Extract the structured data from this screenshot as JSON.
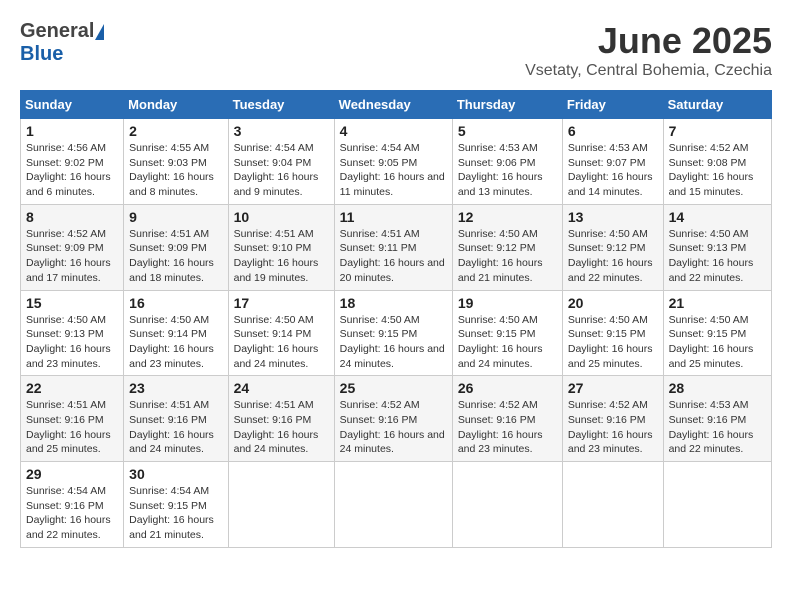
{
  "header": {
    "logo_general": "General",
    "logo_blue": "Blue",
    "month_title": "June 2025",
    "location": "Vsetaty, Central Bohemia, Czechia"
  },
  "weekdays": [
    "Sunday",
    "Monday",
    "Tuesday",
    "Wednesday",
    "Thursday",
    "Friday",
    "Saturday"
  ],
  "weeks": [
    [
      {
        "day": "1",
        "sunrise": "Sunrise: 4:56 AM",
        "sunset": "Sunset: 9:02 PM",
        "daylight": "Daylight: 16 hours and 6 minutes."
      },
      {
        "day": "2",
        "sunrise": "Sunrise: 4:55 AM",
        "sunset": "Sunset: 9:03 PM",
        "daylight": "Daylight: 16 hours and 8 minutes."
      },
      {
        "day": "3",
        "sunrise": "Sunrise: 4:54 AM",
        "sunset": "Sunset: 9:04 PM",
        "daylight": "Daylight: 16 hours and 9 minutes."
      },
      {
        "day": "4",
        "sunrise": "Sunrise: 4:54 AM",
        "sunset": "Sunset: 9:05 PM",
        "daylight": "Daylight: 16 hours and 11 minutes."
      },
      {
        "day": "5",
        "sunrise": "Sunrise: 4:53 AM",
        "sunset": "Sunset: 9:06 PM",
        "daylight": "Daylight: 16 hours and 13 minutes."
      },
      {
        "day": "6",
        "sunrise": "Sunrise: 4:53 AM",
        "sunset": "Sunset: 9:07 PM",
        "daylight": "Daylight: 16 hours and 14 minutes."
      },
      {
        "day": "7",
        "sunrise": "Sunrise: 4:52 AM",
        "sunset": "Sunset: 9:08 PM",
        "daylight": "Daylight: 16 hours and 15 minutes."
      }
    ],
    [
      {
        "day": "8",
        "sunrise": "Sunrise: 4:52 AM",
        "sunset": "Sunset: 9:09 PM",
        "daylight": "Daylight: 16 hours and 17 minutes."
      },
      {
        "day": "9",
        "sunrise": "Sunrise: 4:51 AM",
        "sunset": "Sunset: 9:09 PM",
        "daylight": "Daylight: 16 hours and 18 minutes."
      },
      {
        "day": "10",
        "sunrise": "Sunrise: 4:51 AM",
        "sunset": "Sunset: 9:10 PM",
        "daylight": "Daylight: 16 hours and 19 minutes."
      },
      {
        "day": "11",
        "sunrise": "Sunrise: 4:51 AM",
        "sunset": "Sunset: 9:11 PM",
        "daylight": "Daylight: 16 hours and 20 minutes."
      },
      {
        "day": "12",
        "sunrise": "Sunrise: 4:50 AM",
        "sunset": "Sunset: 9:12 PM",
        "daylight": "Daylight: 16 hours and 21 minutes."
      },
      {
        "day": "13",
        "sunrise": "Sunrise: 4:50 AM",
        "sunset": "Sunset: 9:12 PM",
        "daylight": "Daylight: 16 hours and 22 minutes."
      },
      {
        "day": "14",
        "sunrise": "Sunrise: 4:50 AM",
        "sunset": "Sunset: 9:13 PM",
        "daylight": "Daylight: 16 hours and 22 minutes."
      }
    ],
    [
      {
        "day": "15",
        "sunrise": "Sunrise: 4:50 AM",
        "sunset": "Sunset: 9:13 PM",
        "daylight": "Daylight: 16 hours and 23 minutes."
      },
      {
        "day": "16",
        "sunrise": "Sunrise: 4:50 AM",
        "sunset": "Sunset: 9:14 PM",
        "daylight": "Daylight: 16 hours and 23 minutes."
      },
      {
        "day": "17",
        "sunrise": "Sunrise: 4:50 AM",
        "sunset": "Sunset: 9:14 PM",
        "daylight": "Daylight: 16 hours and 24 minutes."
      },
      {
        "day": "18",
        "sunrise": "Sunrise: 4:50 AM",
        "sunset": "Sunset: 9:15 PM",
        "daylight": "Daylight: 16 hours and 24 minutes."
      },
      {
        "day": "19",
        "sunrise": "Sunrise: 4:50 AM",
        "sunset": "Sunset: 9:15 PM",
        "daylight": "Daylight: 16 hours and 24 minutes."
      },
      {
        "day": "20",
        "sunrise": "Sunrise: 4:50 AM",
        "sunset": "Sunset: 9:15 PM",
        "daylight": "Daylight: 16 hours and 25 minutes."
      },
      {
        "day": "21",
        "sunrise": "Sunrise: 4:50 AM",
        "sunset": "Sunset: 9:15 PM",
        "daylight": "Daylight: 16 hours and 25 minutes."
      }
    ],
    [
      {
        "day": "22",
        "sunrise": "Sunrise: 4:51 AM",
        "sunset": "Sunset: 9:16 PM",
        "daylight": "Daylight: 16 hours and 25 minutes."
      },
      {
        "day": "23",
        "sunrise": "Sunrise: 4:51 AM",
        "sunset": "Sunset: 9:16 PM",
        "daylight": "Daylight: 16 hours and 24 minutes."
      },
      {
        "day": "24",
        "sunrise": "Sunrise: 4:51 AM",
        "sunset": "Sunset: 9:16 PM",
        "daylight": "Daylight: 16 hours and 24 minutes."
      },
      {
        "day": "25",
        "sunrise": "Sunrise: 4:52 AM",
        "sunset": "Sunset: 9:16 PM",
        "daylight": "Daylight: 16 hours and 24 minutes."
      },
      {
        "day": "26",
        "sunrise": "Sunrise: 4:52 AM",
        "sunset": "Sunset: 9:16 PM",
        "daylight": "Daylight: 16 hours and 23 minutes."
      },
      {
        "day": "27",
        "sunrise": "Sunrise: 4:52 AM",
        "sunset": "Sunset: 9:16 PM",
        "daylight": "Daylight: 16 hours and 23 minutes."
      },
      {
        "day": "28",
        "sunrise": "Sunrise: 4:53 AM",
        "sunset": "Sunset: 9:16 PM",
        "daylight": "Daylight: 16 hours and 22 minutes."
      }
    ],
    [
      {
        "day": "29",
        "sunrise": "Sunrise: 4:54 AM",
        "sunset": "Sunset: 9:16 PM",
        "daylight": "Daylight: 16 hours and 22 minutes."
      },
      {
        "day": "30",
        "sunrise": "Sunrise: 4:54 AM",
        "sunset": "Sunset: 9:15 PM",
        "daylight": "Daylight: 16 hours and 21 minutes."
      },
      null,
      null,
      null,
      null,
      null
    ]
  ]
}
